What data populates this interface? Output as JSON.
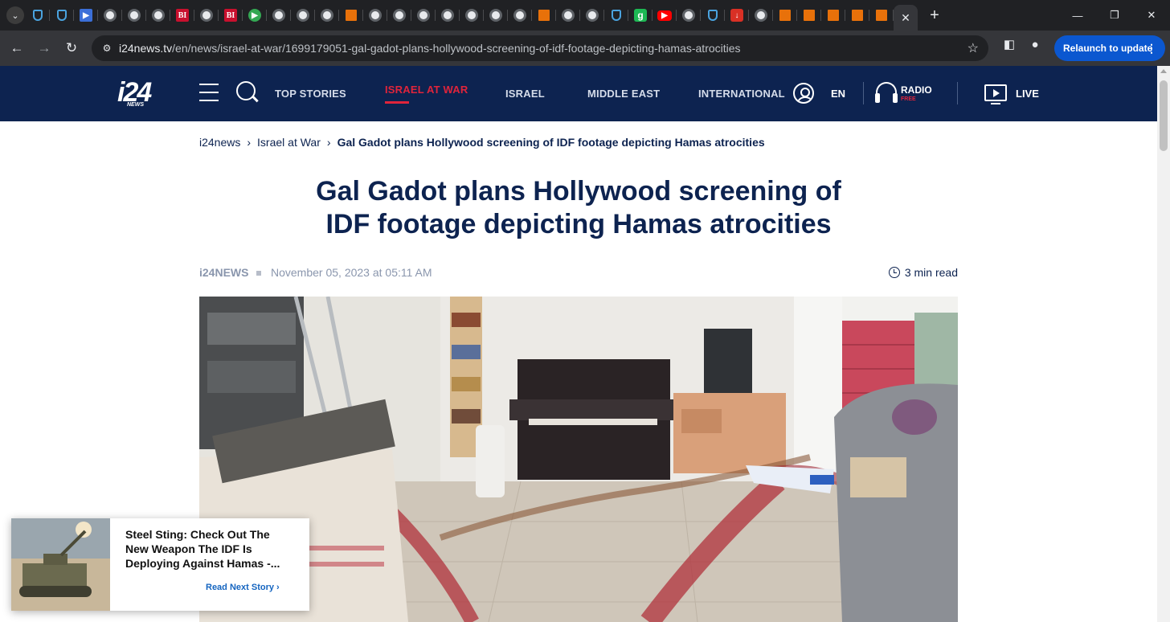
{
  "browser": {
    "active_tab_close": "✕",
    "new_tab": "+",
    "url_host": "i24news.tv",
    "url_path": "/en/news/israel-at-war/1699179051-gal-gadot-plans-hollywood-screening-of-idf-footage-depicting-hamas-atrocities",
    "relaunch_label": "Relaunch to update",
    "tab_favicons": [
      "shield",
      "shield",
      "dblue",
      "globe",
      "globe",
      "globe",
      "bi",
      "globe",
      "bi",
      "play",
      "globe",
      "globe",
      "globe",
      "bookmark",
      "globe",
      "globe",
      "globe",
      "globe",
      "globe",
      "globe",
      "globe",
      "bookmark",
      "globe",
      "globe",
      "shield",
      "g",
      "yt",
      "globe",
      "shield",
      "down",
      "globe",
      "bookmark",
      "bookmark",
      "bookmark",
      "bookmark",
      "bookmark"
    ]
  },
  "site": {
    "logo": "i24",
    "logo_sub": "NEWS",
    "nav": [
      "TOP STORIES",
      "ISRAEL AT WAR",
      "ISRAEL",
      "MIDDLE EAST",
      "INTERNATIONAL"
    ],
    "active_nav": "ISRAEL AT WAR",
    "accent": "#e0243b",
    "header_bg": "#0d2350",
    "language": "EN",
    "radio": "RADIO",
    "radio_badge": "FREE",
    "live": "LIVE"
  },
  "article": {
    "breadcrumb": [
      "i24news",
      "Israel at War",
      "Gal Gadot plans Hollywood screening of IDF footage depicting Hamas atrocities"
    ],
    "title_line1": "Gal Gadot plans Hollywood screening of",
    "title_line2": "IDF footage depicting Hamas atrocities",
    "author": "i24NEWS",
    "date": "November 05, 2023 at 05:11 AM",
    "read_time": "3 min read"
  },
  "next_story": {
    "title": "Steel Sting: Check Out The New Weapon The IDF Is Deploying Against Hamas -...",
    "link": "Read Next Story"
  }
}
